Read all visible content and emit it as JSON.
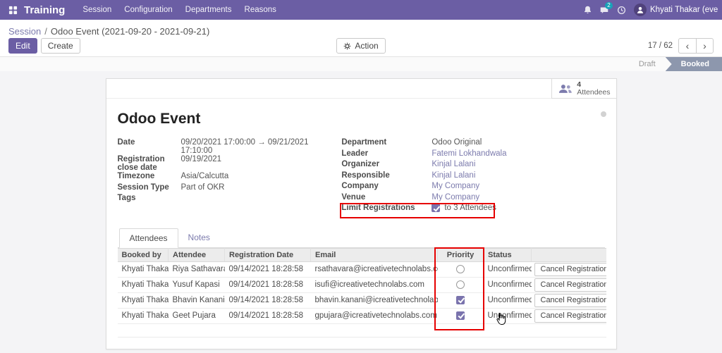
{
  "colors": {
    "navbar_bg": "#6b5ea4",
    "primary_button": "#6b5ea4",
    "link": "#7c7bad",
    "annotation": "#e60000",
    "status_active_bg": "#8d97ad",
    "badge_bg": "#18a2b8"
  },
  "navbar": {
    "app_name": "Training",
    "menu_items": [
      "Session",
      "Configuration",
      "Departments",
      "Reasons"
    ],
    "message_count": "2",
    "user_name": "Khyati Thakar (event_mgmt"
  },
  "breadcrumb": {
    "parent": "Session",
    "separator": "/",
    "current": "Odoo Event (2021-09-20 - 2021-09-21)"
  },
  "control": {
    "edit_label": "Edit",
    "create_label": "Create",
    "action_label": "Action",
    "pager": "17 / 62",
    "prev": "‹",
    "next": "›"
  },
  "statusbar": {
    "draft": "Draft",
    "booked": "Booked"
  },
  "sheet": {
    "stat_button": {
      "value": "4",
      "label": "Attendees"
    },
    "title": "Odoo Event",
    "fields_left": [
      {
        "label": "Date",
        "value": "09/20/2021 17:00:00  →  09/21/2021 17:10:00"
      },
      {
        "label": "Registration close date",
        "value": "09/19/2021"
      },
      {
        "label": "Timezone",
        "value": "Asia/Calcutta"
      },
      {
        "label": "Session Type",
        "value": "Part of OKR"
      },
      {
        "label": "Tags",
        "value": ""
      }
    ],
    "fields_right": [
      {
        "label": "Department",
        "value": "Odoo Original"
      },
      {
        "label": "Leader",
        "value": "Fatemi Lokhandwala"
      },
      {
        "label": "Organizer",
        "value": "Kinjal Lalani"
      },
      {
        "label": "Responsible",
        "value": "Kinjal Lalani"
      },
      {
        "label": "Company",
        "value": "My Company"
      },
      {
        "label": "Venue",
        "value": "My Company"
      }
    ],
    "limit_registrations": {
      "label": "Limit Registrations",
      "checked": true,
      "value": "to 3 Attendees"
    }
  },
  "tabs": {
    "attendees": "Attendees",
    "notes": "Notes"
  },
  "table": {
    "headers": [
      "Booked by",
      "Attendee",
      "Registration Date",
      "Email",
      "Priority",
      "Status",
      ""
    ],
    "rows": [
      {
        "booked_by": "Khyati Thakar",
        "attendee": "Riya Sathavara",
        "registration_date": "09/14/2021 18:28:58",
        "email": "rsathavara@icreativetechnolabs.com",
        "priority": false,
        "status": "Unconfirmed",
        "action": "Cancel Registration"
      },
      {
        "booked_by": "Khyati Thakar",
        "attendee": "Yusuf Kapasi",
        "registration_date": "09/14/2021 18:28:58",
        "email": "isufi@icreativetechnolabs.com",
        "priority": false,
        "status": "Unconfirmed",
        "action": "Cancel Registration"
      },
      {
        "booked_by": "Khyati Thakar",
        "attendee": "Bhavin Kanani",
        "registration_date": "09/14/2021 18:28:58",
        "email": "bhavin.kanani@icreativetechnolabs.com",
        "priority": true,
        "status": "Unconfirmed",
        "action": "Cancel Registration"
      },
      {
        "booked_by": "Khyati Thakar",
        "attendee": "Geet Pujara",
        "registration_date": "09/14/2021 18:28:58",
        "email": "gpujara@icreativetechnolabs.com",
        "priority": true,
        "status": "Unconfirmed",
        "action": "Cancel Registration"
      }
    ]
  },
  "icons": {
    "apps_menu": "grid",
    "bell": "bell",
    "chat": "chat-bubble",
    "activity": "clock",
    "attendees": "users-group",
    "action": "gear",
    "cursor": "hand-pointer"
  }
}
